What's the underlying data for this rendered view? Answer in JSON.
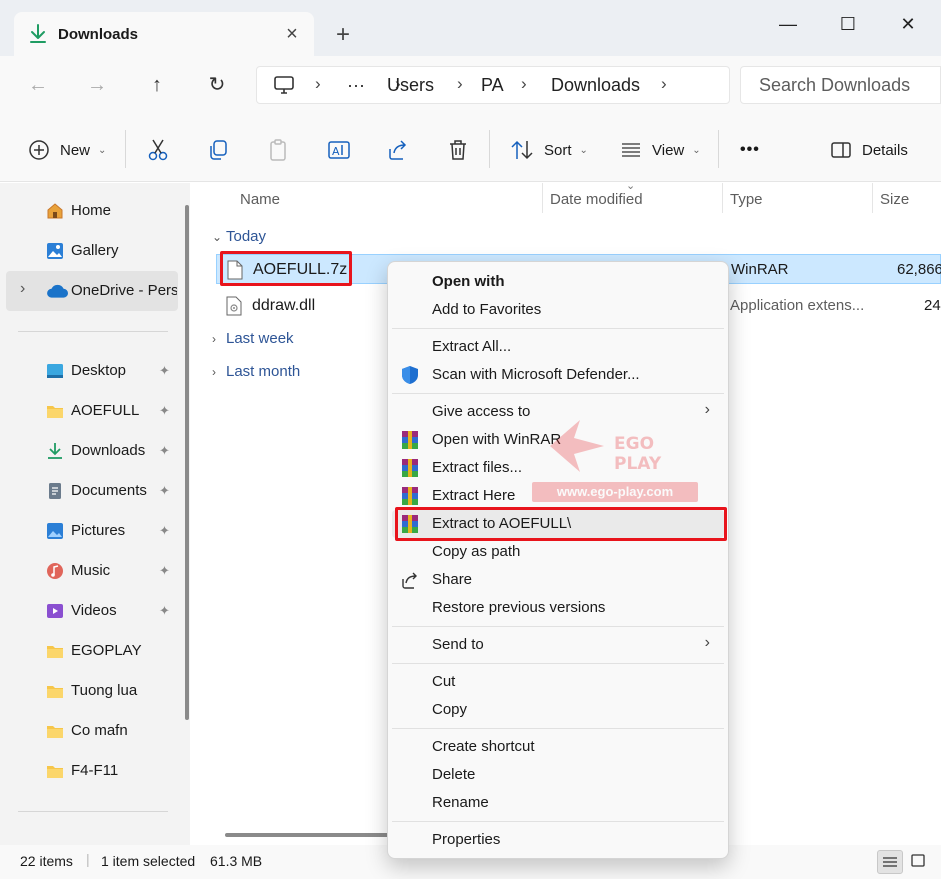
{
  "window": {
    "tab_title": "Downloads",
    "tab_close_icon": "×",
    "new_tab_icon": "+",
    "minimize_icon": "—",
    "maximize_icon": "☐",
    "close_icon": "✕"
  },
  "address": {
    "nav_back": "←",
    "nav_forward": "→",
    "nav_up": "↑",
    "nav_refresh": "↻",
    "ellipsis": "···",
    "crumbs": [
      "Users",
      "PA",
      "Downloads"
    ],
    "separator": "›",
    "search_placeholder": "Search Downloads"
  },
  "toolbar": {
    "new_label": "New",
    "sort_label": "Sort",
    "view_label": "View",
    "more_label": "•••",
    "details_label": "Details",
    "chevron": "⌄"
  },
  "sidebar": {
    "items": [
      {
        "label": "Home"
      },
      {
        "label": "Gallery"
      },
      {
        "label": "OneDrive - Personal"
      },
      {
        "label": "Desktop"
      },
      {
        "label": "AOEFULL"
      },
      {
        "label": "Downloads"
      },
      {
        "label": "Documents"
      },
      {
        "label": "Pictures"
      },
      {
        "label": "Music"
      },
      {
        "label": "Videos"
      },
      {
        "label": "EGOPLAY"
      },
      {
        "label": "Tuong lua"
      },
      {
        "label": "Co mafn"
      },
      {
        "label": "F4-F11"
      }
    ],
    "expand_chevron": "›",
    "pin_icon": "📌"
  },
  "filelist": {
    "columns": {
      "name": "Name",
      "date": "Date modified",
      "type": "Type",
      "size": "Size"
    },
    "groups": {
      "today": "Today",
      "last_week": "Last week",
      "last_month": "Last month"
    },
    "rows": [
      {
        "name": "AOEFULL.7z",
        "type": "WinRAR",
        "size": "62,866"
      },
      {
        "name": "ddraw.dll",
        "type": "Application extens...",
        "size": "24"
      }
    ]
  },
  "status": {
    "item_count": "22 items",
    "selection": "1 item selected",
    "size": "61.3 MB"
  },
  "context_menu": {
    "open_with": "Open with",
    "add_favorites": "Add to Favorites",
    "extract_all": "Extract All...",
    "scan_defender": "Scan with Microsoft Defender...",
    "give_access": "Give access to",
    "open_winrar": "Open with WinRAR",
    "extract_files": "Extract files...",
    "extract_here": "Extract Here",
    "extract_to": "Extract to AOEFULL\\",
    "copy_path": "Copy as path",
    "share": "Share",
    "restore": "Restore previous versions",
    "send_to": "Send to",
    "cut": "Cut",
    "copy": "Copy",
    "create_shortcut": "Create shortcut",
    "delete": "Delete",
    "rename": "Rename",
    "properties": "Properties",
    "arrow": "›"
  },
  "watermark": {
    "brand": "EGO PLAY",
    "url": "www.ego-play.com"
  },
  "colors": {
    "accent": "#0067c0",
    "selection": "#cce8ff",
    "highlight_box": "#e8141c",
    "group_link": "#2e5596"
  }
}
